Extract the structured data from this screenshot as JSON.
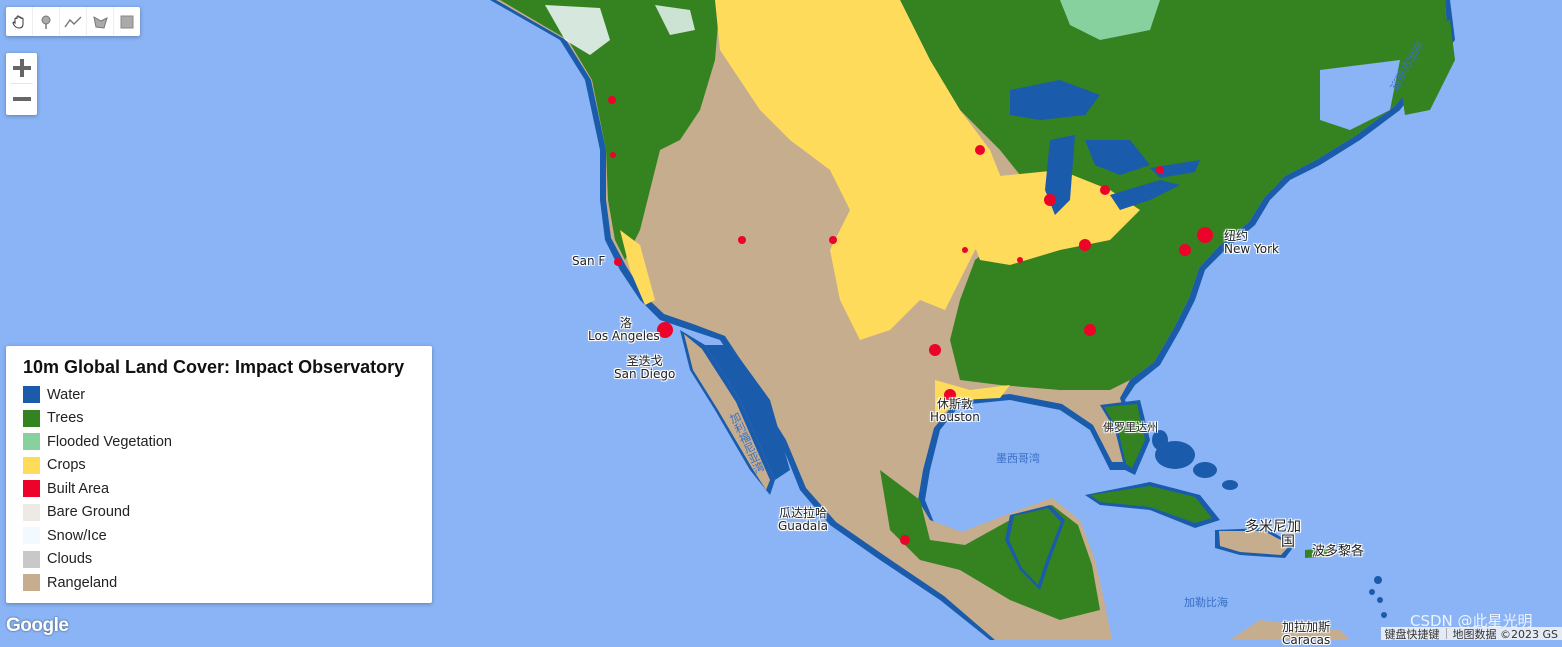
{
  "map": {
    "ocean_color": "#8ab4f6",
    "labels": [
      {
        "id": "san-francisco",
        "lines": [
          "San F"
        ]
      },
      {
        "id": "los-angeles",
        "lines": [
          "洛",
          "Los Angeles"
        ]
      },
      {
        "id": "san-diego",
        "lines": [
          "圣迭戈",
          "San Diego"
        ]
      },
      {
        "id": "new-york",
        "lines": [
          "纽约",
          "New York"
        ]
      },
      {
        "id": "houston",
        "lines": [
          "休斯敦",
          "Houston"
        ]
      },
      {
        "id": "guadalajara",
        "lines": [
          "瓜达拉哈",
          "Guadala"
        ]
      },
      {
        "id": "dominican-republic",
        "lines": [
          "多米尼加",
          "国"
        ]
      },
      {
        "id": "puerto-rico",
        "lines": [
          "波多黎各"
        ]
      },
      {
        "id": "caracas",
        "lines": [
          "加拉加斯",
          "Caracas"
        ]
      },
      {
        "id": "florida",
        "lines": [
          "佛罗里达州"
        ]
      }
    ],
    "sea_labels": [
      {
        "id": "gulf-of-mexico",
        "text": "墨西哥湾"
      },
      {
        "id": "caribbean-sea",
        "text": "加勒比海"
      },
      {
        "id": "gulf-of-california",
        "text": "加利福尼亚湾"
      },
      {
        "id": "gulf-of-st-lawrence",
        "text": "圣劳伦斯湾"
      }
    ]
  },
  "toolbar": {
    "tools": [
      {
        "name": "pan-hand",
        "title": "Pan"
      },
      {
        "name": "point-marker",
        "title": "Add a marker"
      },
      {
        "name": "line",
        "title": "Draw a line"
      },
      {
        "name": "polygon",
        "title": "Draw a shape"
      },
      {
        "name": "rectangle",
        "title": "Draw a rectangle"
      }
    ]
  },
  "zoom": {
    "in_label": "+",
    "out_label": "−"
  },
  "legend": {
    "title": "10m Global Land Cover: Impact Observatory",
    "items": [
      {
        "label": "Water",
        "color": "#1a5bab"
      },
      {
        "label": "Trees",
        "color": "#358221"
      },
      {
        "label": "Flooded Vegetation",
        "color": "#87d19e"
      },
      {
        "label": "Crops",
        "color": "#ffdb5c"
      },
      {
        "label": "Built Area",
        "color": "#ed022a"
      },
      {
        "label": "Bare Ground",
        "color": "#ede9e4"
      },
      {
        "label": "Snow/Ice",
        "color": "#f2faff"
      },
      {
        "label": "Clouds",
        "color": "#c8c8c8"
      },
      {
        "label": "Rangeland",
        "color": "#c6ad8d"
      }
    ]
  },
  "footer": {
    "logo": "Google",
    "keyboard_shortcuts": "键盘快捷键",
    "map_data": "地图数据 ©2023 GS",
    "watermark": "CSDN @此星光明"
  }
}
